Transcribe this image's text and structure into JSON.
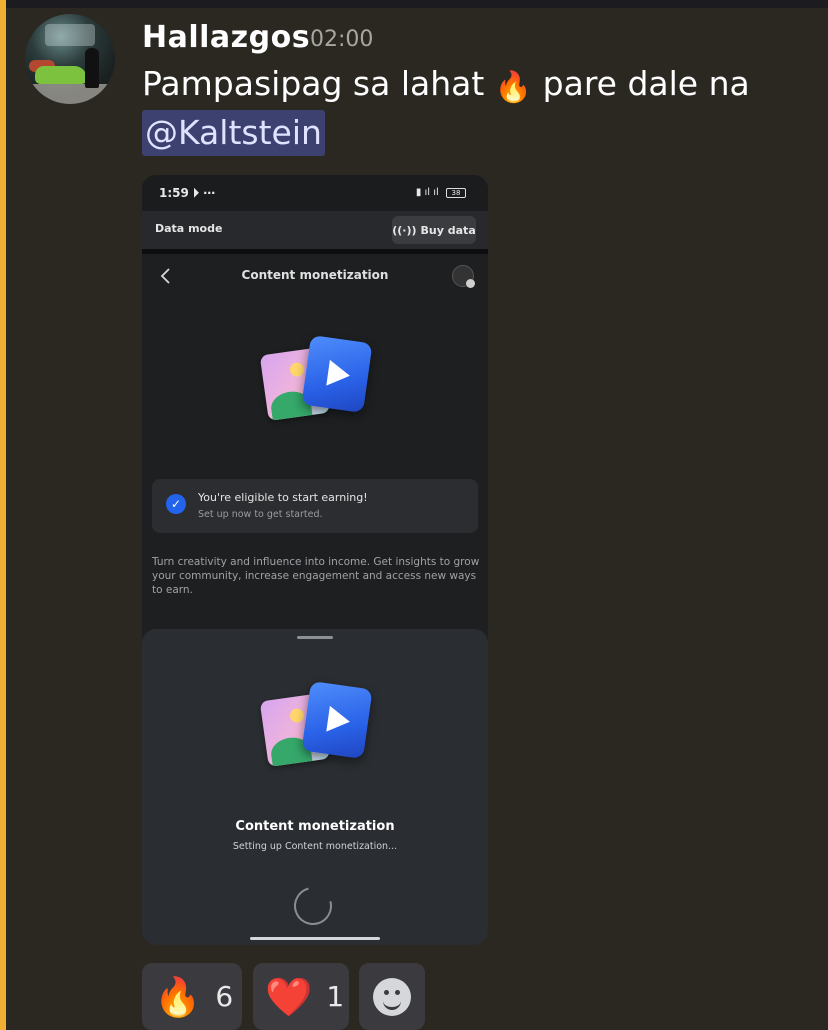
{
  "message": {
    "author": "Hallazgos",
    "timestamp": "02:00",
    "text_before_emoji": "Pampasipag sa lahat ",
    "emoji": "🔥",
    "text_after_emoji": " pare dale na",
    "mention": "@Kaltstein"
  },
  "attachment": {
    "status_bar": {
      "time": "1:59",
      "icons": "⋯",
      "battery": "38"
    },
    "data_bar": {
      "label": "Data mode",
      "buy_button": "Buy data"
    },
    "nav": {
      "title": "Content monetization"
    },
    "eligibility": {
      "title": "You're eligible to start earning!",
      "subtitle": "Set up now to get started."
    },
    "description": "Turn creativity and influence into income. Get insights to grow your community, increase engagement and access new ways to earn.",
    "sheet": {
      "title": "Content monetization",
      "subtitle": "Setting up Content monetization..."
    }
  },
  "reactions": [
    {
      "emoji": "🔥",
      "count": "6"
    },
    {
      "emoji": "❤️",
      "count": "1"
    },
    {
      "emoji": "add-reaction-icon"
    }
  ],
  "colors": {
    "background": "#2b2822",
    "accent_bar": "#f0b132",
    "mention_bg": "#3d4170",
    "primary_blue": "#2463eb"
  }
}
